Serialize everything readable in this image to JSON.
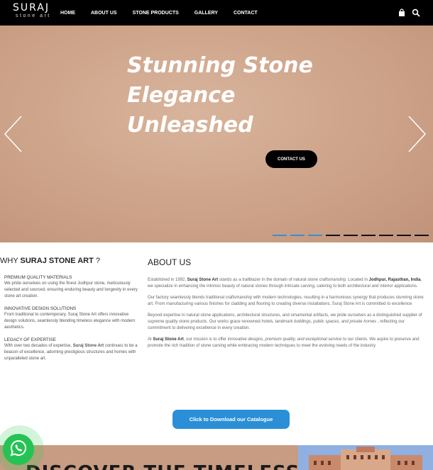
{
  "nav": {
    "logo_main": "SURAJ",
    "logo_sub": "stone art",
    "items": [
      "HOME",
      "ABOUT US",
      "STONE PRODUCTS",
      "GALLERY",
      "CONTACT"
    ],
    "icons": [
      "bag-icon",
      "search-icon"
    ]
  },
  "hero": {
    "title_lines": [
      "Stunning Stone",
      "Elegance",
      "Unleashed"
    ],
    "button": "CONTACT US",
    "slides_total": 9,
    "active_indicators": 3
  },
  "why": {
    "heading_prefix": "WHY ",
    "heading_brand": "SURAJ STONE ART",
    "heading_suffix": " ?",
    "items": [
      {
        "title": "PREMIUM QUALITY MATERIALS",
        "text": "We pride ourselves on using the finest Jodhpur stone, meticulously selected and sourced, ensuring enduring beauty and longevity in every stone art creation."
      },
      {
        "title": "INNOVATIVE DESIGN SOLUTIONS",
        "text": "From traditional to contemporary, Suraj Stone Art offers innovative design solutions, seamlessly blending timeless elegance with modern aesthetics."
      },
      {
        "title": "LEGACY OF EXPERTISE",
        "text_a": "With over two decades of expertise, ",
        "text_b": "Suraj Stone Art",
        "text_c": " continues to be a beacon of excellence, adorning prestigious structures and homes with unparalleled stone art."
      }
    ]
  },
  "about": {
    "heading": "ABOUT US",
    "p1_a": "Established in 1992, ",
    "p1_b": "Suraj Stone Art",
    "p1_c": " stands as a trailblazer in the domain of natural stone craftsmanship. Located in ",
    "p1_d": "Jodhpur, Rajasthan, India",
    "p1_e": ", we specialize in enhancing the intrinsic beauty of natural stones through intricate carving, catering to both architectural and interior applications.",
    "p2": "Our factory seamlessly blends traditional craftsmanship with modern technologies, resulting in a harmonious synergy that produces stunning stone art. From manufacturing various finishes for cladding and flooring to creating diverse installations, Suraj Stone Art is committed to excellence",
    "p3_a": "Beyond expertise in natural stone applications, architectural structures, and ornamental artifacts, we pride ourselves as a distinguished supplier of supreme quality stone products. Our works grace renowned ",
    "p3_b": "hotels, landmark buildings, public spaces, and private homes",
    "p3_c": " , reflecting our commitment to delivering excellence in every creation.",
    "p4_a": "At ",
    "p4_b": "Suraj Stone Art",
    "p4_c": ", our mission is to offer ",
    "p4_d": "innovative designs, premium quality, and exceptional service",
    "p4_e": " to our clients. We aspire to preserve and promote the rich tradition of stone carving while embracing modern techniques to meet the evolving needs of the industry."
  },
  "download_button": "Click to Download our Catalogue",
  "bottom_title": "DISCOVER THE TIMELESS",
  "colors": {
    "nav_bg": "#000000",
    "accent_blue": "#2a8fd6",
    "whatsapp_green": "#25c353",
    "stone_tan": "#cfa68c"
  }
}
